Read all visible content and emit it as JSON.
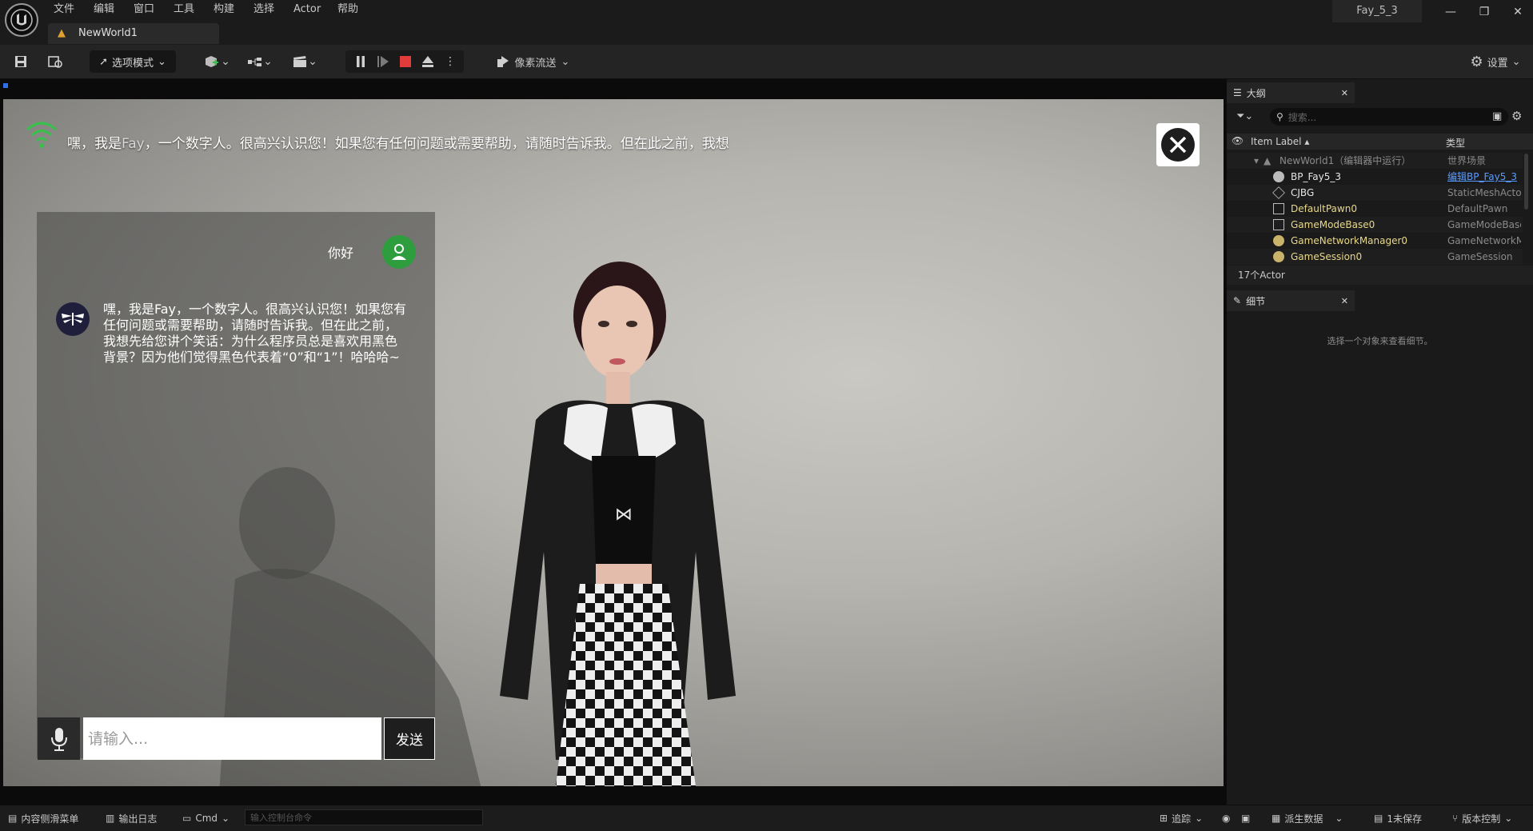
{
  "menu": [
    "文件",
    "编辑",
    "窗口",
    "工具",
    "构建",
    "选择",
    "Actor",
    "帮助"
  ],
  "document_tab": "NewWorld1",
  "project_name": "Fay_5_3",
  "toolbar": {
    "mode_label": "选项模式",
    "pixel_streaming_label": "像素流送",
    "settings_label": "设置"
  },
  "viewport": {
    "subtitle_prefix": "嘿，我是",
    "subtitle_name": "Fay",
    "subtitle_suffix": "，一个数字人。很高兴认识您！如果您有任何问题或需要帮助，请随时告诉我。但在此之前，我想"
  },
  "chat": {
    "user_message": "你好",
    "bot_message": "嘿，我是Fay，一个数字人。很高兴认识您！如果您有任何问题或需要帮助，请随时告诉我。但在此之前，我想先给您讲个笑话：为什么程序员总是喜欢用黑色背景？因为他们觉得黑色代表着“0”和“1”！哈哈哈~",
    "input_placeholder": "请输入...",
    "send_label": "发送"
  },
  "outliner": {
    "tab_label": "大纲",
    "search_placeholder": "搜索...",
    "col_label": "Item Label",
    "col_type": "类型",
    "world_row": {
      "label": "NewWorld1（编辑器中运行）",
      "type": "世界场景"
    },
    "rows": [
      {
        "label": "BP_Fay5_3",
        "type": "编辑BP_Fay5_3",
        "icon": "blueprint-icon"
      },
      {
        "label": "CJBG",
        "type": "StaticMeshActor",
        "icon": "static-mesh-icon"
      },
      {
        "label": "DefaultPawn0",
        "type": "DefaultPawn",
        "icon": "pawn-icon"
      },
      {
        "label": "GameModeBase0",
        "type": "GameModeBase",
        "icon": "game-mode-icon"
      },
      {
        "label": "GameNetworkManager0",
        "type": "GameNetworkManager",
        "icon": "actor-icon"
      },
      {
        "label": "GameSession0",
        "type": "GameSession",
        "icon": "actor-icon"
      }
    ],
    "actor_count": "17个Actor"
  },
  "details": {
    "tab_label": "细节",
    "empty_text": "选择一个对象来查看细节。"
  },
  "statusbar": {
    "content_drawer": "内容侧滑菜单",
    "output_log": "输出日志",
    "cmd": "Cmd",
    "console_placeholder": "输入控制台命令",
    "trace": "追踪",
    "derived_data": "派生数据",
    "unsaved": "1未保存",
    "source_control": "版本控制"
  }
}
